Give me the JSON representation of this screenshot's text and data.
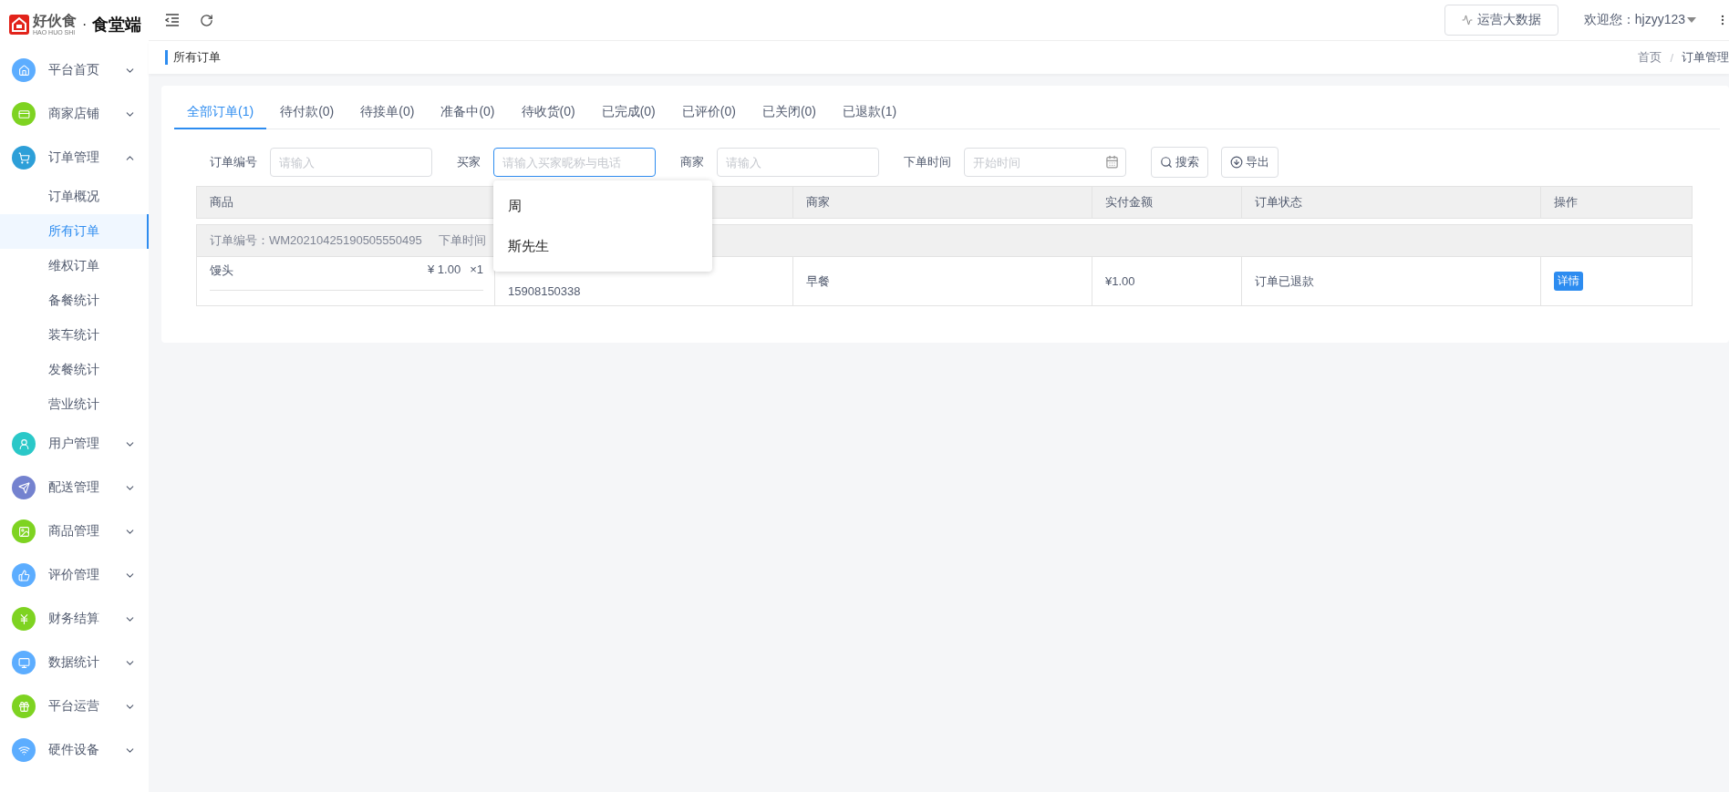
{
  "logo": {
    "brand": "好伙食",
    "brand_sub": "HAO HUO SHI",
    "separator": "·",
    "product": "食堂端"
  },
  "header": {
    "data_button": "运营大数据",
    "welcome": "欢迎您：hjzyy123"
  },
  "page_title": "所有订单",
  "breadcrumb": {
    "items": [
      "首页",
      "订单管理"
    ],
    "separator": "/"
  },
  "sidebar": [
    {
      "label": "平台首页",
      "color": "#5cadff",
      "expanded": false
    },
    {
      "label": "商家店铺",
      "color": "#7ed321",
      "expanded": false
    },
    {
      "label": "订单管理",
      "color": "#2d9fd8",
      "expanded": true,
      "children": [
        {
          "label": "订单概况",
          "selected": false
        },
        {
          "label": "所有订单",
          "selected": true
        },
        {
          "label": "维权订单",
          "selected": false
        },
        {
          "label": "备餐统计",
          "selected": false
        },
        {
          "label": "装车统计",
          "selected": false
        },
        {
          "label": "发餐统计",
          "selected": false
        },
        {
          "label": "营业统计",
          "selected": false
        }
      ]
    },
    {
      "label": "用户管理",
      "color": "#2ac8c8",
      "expanded": false
    },
    {
      "label": "配送管理",
      "color": "#7482cf",
      "expanded": false
    },
    {
      "label": "商品管理",
      "color": "#7ed321",
      "expanded": false
    },
    {
      "label": "评价管理",
      "color": "#5cadff",
      "expanded": false
    },
    {
      "label": "财务结算",
      "color": "#7ed321",
      "expanded": false
    },
    {
      "label": "数据统计",
      "color": "#5cadff",
      "expanded": false
    },
    {
      "label": "平台运营",
      "color": "#7ed321",
      "expanded": false
    },
    {
      "label": "硬件设备",
      "color": "#5cadff",
      "expanded": false
    }
  ],
  "tabs": [
    {
      "label": "全部订单(1)",
      "selected": true
    },
    {
      "label": "待付款(0)",
      "selected": false
    },
    {
      "label": "待接单(0)",
      "selected": false
    },
    {
      "label": "准备中(0)",
      "selected": false
    },
    {
      "label": "待收货(0)",
      "selected": false
    },
    {
      "label": "已完成(0)",
      "selected": false
    },
    {
      "label": "已评价(0)",
      "selected": false
    },
    {
      "label": "已关闭(0)",
      "selected": false
    },
    {
      "label": "已退款(1)",
      "selected": false
    }
  ],
  "filters": [
    {
      "kind": "text",
      "label": "订单编号",
      "placeholder": "请输入",
      "focused": false
    },
    {
      "kind": "text",
      "label": "买家",
      "placeholder": "请输入买家昵称与电话",
      "focused": true
    },
    {
      "kind": "text",
      "label": "商家",
      "placeholder": "请输入",
      "focused": false
    },
    {
      "kind": "date",
      "label": "下单时间",
      "placeholder": "开始时间",
      "focused": false
    }
  ],
  "buttons": [
    {
      "kind": "search",
      "label": "搜索"
    },
    {
      "kind": "export",
      "label": "导出"
    }
  ],
  "buyer_suggestions": [
    "周",
    "斯先生"
  ],
  "table": {
    "columns": {
      "goods": "商品",
      "merchant": "商家",
      "amount": "实付金额",
      "status": "订单状态",
      "action": "操作"
    },
    "orders": [
      {
        "number_label": "订单编号：WM20210425190505550495",
        "time_label": "下单时间",
        "items": [
          {
            "name": "馒头",
            "price": "¥ 1.00",
            "qty": "×1"
          }
        ],
        "buyer_phone": "15908150338",
        "merchant": "早餐",
        "amount": "¥1.00",
        "status": "订单已退款",
        "action": "详情"
      }
    ]
  }
}
